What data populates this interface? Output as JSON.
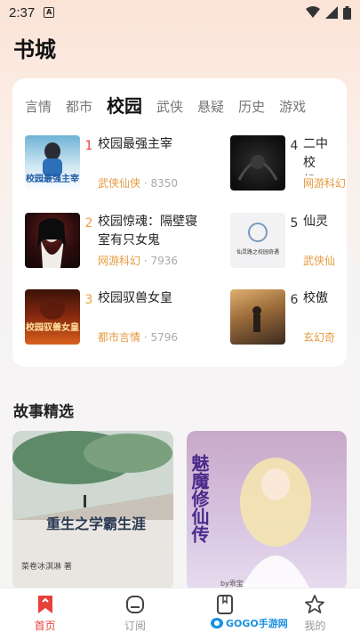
{
  "status_bar": {
    "time": "2:37",
    "notification_letter": "A"
  },
  "header": {
    "title": "书城"
  },
  "categories": {
    "tabs": [
      "言情",
      "都市",
      "校园",
      "武侠",
      "悬疑",
      "历史",
      "游戏"
    ],
    "active": "校园"
  },
  "rankings": [
    {
      "rank": "1",
      "title": "校园最强主宰",
      "genre": "武侠仙侠",
      "count": "8350"
    },
    {
      "rank": "2",
      "title": "校园惊魂：隔壁寝室有只女鬼",
      "genre": "网游科幻",
      "count": "7936"
    },
    {
      "rank": "3",
      "title": "校园驭兽女皇",
      "genre": "都市言情",
      "count": "5796"
    },
    {
      "rank": "4",
      "title": "二中校草的小蛮妻机",
      "title_visible": "二中机",
      "genre": "网游科幻",
      "count": ""
    },
    {
      "rank": "5",
      "title": "仙灵",
      "genre": "武侠仙",
      "count": ""
    },
    {
      "rank": "6",
      "title": "校傲",
      "genre": "玄幻奇",
      "count": ""
    }
  ],
  "covers": {
    "book1_text": "校园最强主宰",
    "book3_text": "校园驭兽女皇",
    "book5_text": "仙灵路之校园奇遇"
  },
  "stories_section": {
    "title": "故事精选",
    "cards": [
      {
        "cover_text": "重生之学霸生涯",
        "author_text": "菜卷冰淇淋 著"
      },
      {
        "cover_text": "魅魔修仙传",
        "author_text": "by乖宝"
      }
    ]
  },
  "bottom_nav": [
    {
      "label": "首页",
      "icon": "bookmark-home-icon",
      "active": true
    },
    {
      "label": "订阅",
      "icon": "subscribe-icon",
      "active": false
    },
    {
      "label": "书架",
      "icon": "bookshelf-icon",
      "active": false
    },
    {
      "label": "我的",
      "icon": "star-profile-icon",
      "active": false
    }
  ],
  "watermark": {
    "text": "GOGO手游网"
  },
  "colors": {
    "accent": "#e8413a",
    "meta": "#e59a3e",
    "rank_red": "#e8413a",
    "rank_orange": "#f0a040"
  }
}
